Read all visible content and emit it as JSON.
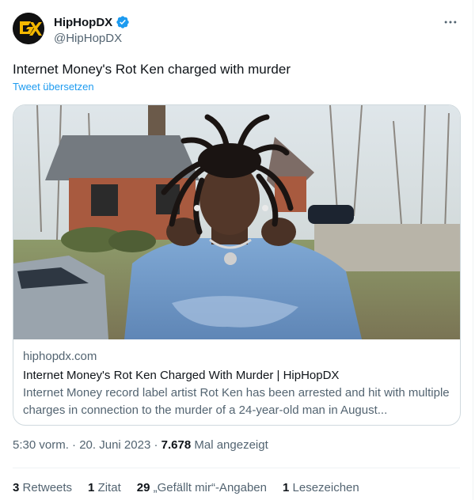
{
  "author": {
    "display_name": "HipHopDX",
    "handle": "@HipHopDX",
    "avatar_letters": "DX",
    "verified": true
  },
  "tweet": {
    "text": "Internet Money's Rot Ken charged with murder",
    "translate_label": "Tweet übersetzen"
  },
  "card": {
    "domain": "hiphopdx.com",
    "title": "Internet Money's Rot Ken Charged With Murder | HipHopDX",
    "description": "Internet Money record label artist Rot Ken has been arrested and hit with multiple charges in connection to the murder of a 24-year-old man in August..."
  },
  "meta": {
    "time": "5:30 vorm.",
    "separator": "·",
    "date": "20. Juni 2023",
    "views_count": "7.678",
    "views_label": "Mal angezeigt"
  },
  "stats": {
    "retweets_count": "3",
    "retweets_label": "Retweets",
    "quotes_count": "1",
    "quotes_label": "Zitat",
    "likes_count": "29",
    "likes_label": "„Gefällt mir“-Angaben",
    "bookmarks_count": "1",
    "bookmarks_label": "Lesezeichen"
  },
  "colors": {
    "accent": "#1d9bf0",
    "avatar_gold": "#f5b800",
    "secondary_text": "#536471"
  },
  "icons": {
    "verified": "verified-badge-icon",
    "more": "more-dots-icon"
  }
}
